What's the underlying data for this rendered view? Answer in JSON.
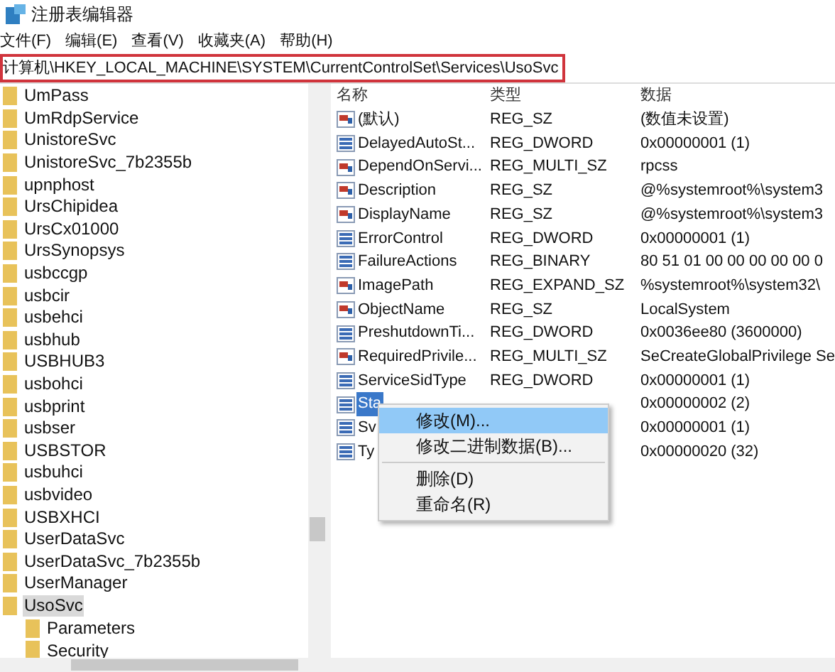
{
  "window": {
    "title": "注册表编辑器"
  },
  "menu_bar": [
    "文件(F)",
    "编辑(E)",
    "查看(V)",
    "收藏夹(A)",
    "帮助(H)"
  ],
  "address_bar": {
    "value": "计算机\\HKEY_LOCAL_MACHINE\\SYSTEM\\CurrentControlSet\\Services\\UsoSvc"
  },
  "tree": {
    "items": [
      {
        "label": "UmPass",
        "selected": false
      },
      {
        "label": "UmRdpService",
        "selected": false
      },
      {
        "label": "UnistoreSvc",
        "selected": false
      },
      {
        "label": "UnistoreSvc_7b2355b",
        "selected": false
      },
      {
        "label": "upnphost",
        "selected": false
      },
      {
        "label": "UrsChipidea",
        "selected": false
      },
      {
        "label": "UrsCx01000",
        "selected": false
      },
      {
        "label": "UrsSynopsys",
        "selected": false
      },
      {
        "label": "usbccgp",
        "selected": false
      },
      {
        "label": "usbcir",
        "selected": false
      },
      {
        "label": "usbehci",
        "selected": false
      },
      {
        "label": "usbhub",
        "selected": false
      },
      {
        "label": "USBHUB3",
        "selected": false
      },
      {
        "label": "usbohci",
        "selected": false
      },
      {
        "label": "usbprint",
        "selected": false
      },
      {
        "label": "usbser",
        "selected": false
      },
      {
        "label": "USBSTOR",
        "selected": false
      },
      {
        "label": "usbuhci",
        "selected": false
      },
      {
        "label": "usbvideo",
        "selected": false
      },
      {
        "label": "USBXHCI",
        "selected": false
      },
      {
        "label": "UserDataSvc",
        "selected": false
      },
      {
        "label": "UserDataSvc_7b2355b",
        "selected": false
      },
      {
        "label": "UserManager",
        "selected": false
      },
      {
        "label": "UsoSvc",
        "selected": true,
        "children": [
          {
            "label": "Parameters",
            "selected": false
          },
          {
            "label": "Security",
            "selected": false
          }
        ]
      }
    ]
  },
  "values": {
    "columns": [
      "名称",
      "类型",
      "数据"
    ],
    "rows": [
      {
        "kind": "string",
        "name": "(默认)",
        "type": "REG_SZ",
        "data": "(数值未设置)",
        "selected": false
      },
      {
        "kind": "binary",
        "name": "DelayedAutoSt...",
        "type": "REG_DWORD",
        "data": "0x00000001 (1)",
        "selected": false
      },
      {
        "kind": "string",
        "name": "DependOnServi...",
        "type": "REG_MULTI_SZ",
        "data": "rpcss",
        "selected": false
      },
      {
        "kind": "string",
        "name": "Description",
        "type": "REG_SZ",
        "data": "@%systemroot%\\system3",
        "selected": false
      },
      {
        "kind": "string",
        "name": "DisplayName",
        "type": "REG_SZ",
        "data": "@%systemroot%\\system3",
        "selected": false
      },
      {
        "kind": "binary",
        "name": "ErrorControl",
        "type": "REG_DWORD",
        "data": "0x00000001 (1)",
        "selected": false
      },
      {
        "kind": "binary",
        "name": "FailureActions",
        "type": "REG_BINARY",
        "data": "80 51 01 00 00 00 00 00 0",
        "selected": false
      },
      {
        "kind": "string",
        "name": "ImagePath",
        "type": "REG_EXPAND_SZ",
        "data": "%systemroot%\\system32\\",
        "selected": false
      },
      {
        "kind": "string",
        "name": "ObjectName",
        "type": "REG_SZ",
        "data": "LocalSystem",
        "selected": false
      },
      {
        "kind": "binary",
        "name": "PreshutdownTi...",
        "type": "REG_DWORD",
        "data": "0x0036ee80 (3600000)",
        "selected": false
      },
      {
        "kind": "string",
        "name": "RequiredPrivile...",
        "type": "REG_MULTI_SZ",
        "data": "SeCreateGlobalPrivilege Se",
        "selected": false
      },
      {
        "kind": "binary",
        "name": "ServiceSidType",
        "type": "REG_DWORD",
        "data": "0x00000001 (1)",
        "selected": false
      },
      {
        "kind": "binary",
        "name": "Sta",
        "data": "0x00000002 (2)",
        "selected": true
      },
      {
        "kind": "binary",
        "name": "Sv",
        "data": "0x00000001 (1)",
        "selected": false
      },
      {
        "kind": "binary",
        "name": "Ty",
        "data": "0x00000020 (32)",
        "selected": false
      }
    ]
  },
  "context_menu": {
    "items": [
      {
        "label": "修改(M)...",
        "selected": true
      },
      {
        "label": "修改二进制数据(B)...",
        "selected": false,
        "separator_after": true
      },
      {
        "label": "删除(D)",
        "selected": false
      },
      {
        "label": "重命名(R)",
        "selected": false
      }
    ]
  }
}
